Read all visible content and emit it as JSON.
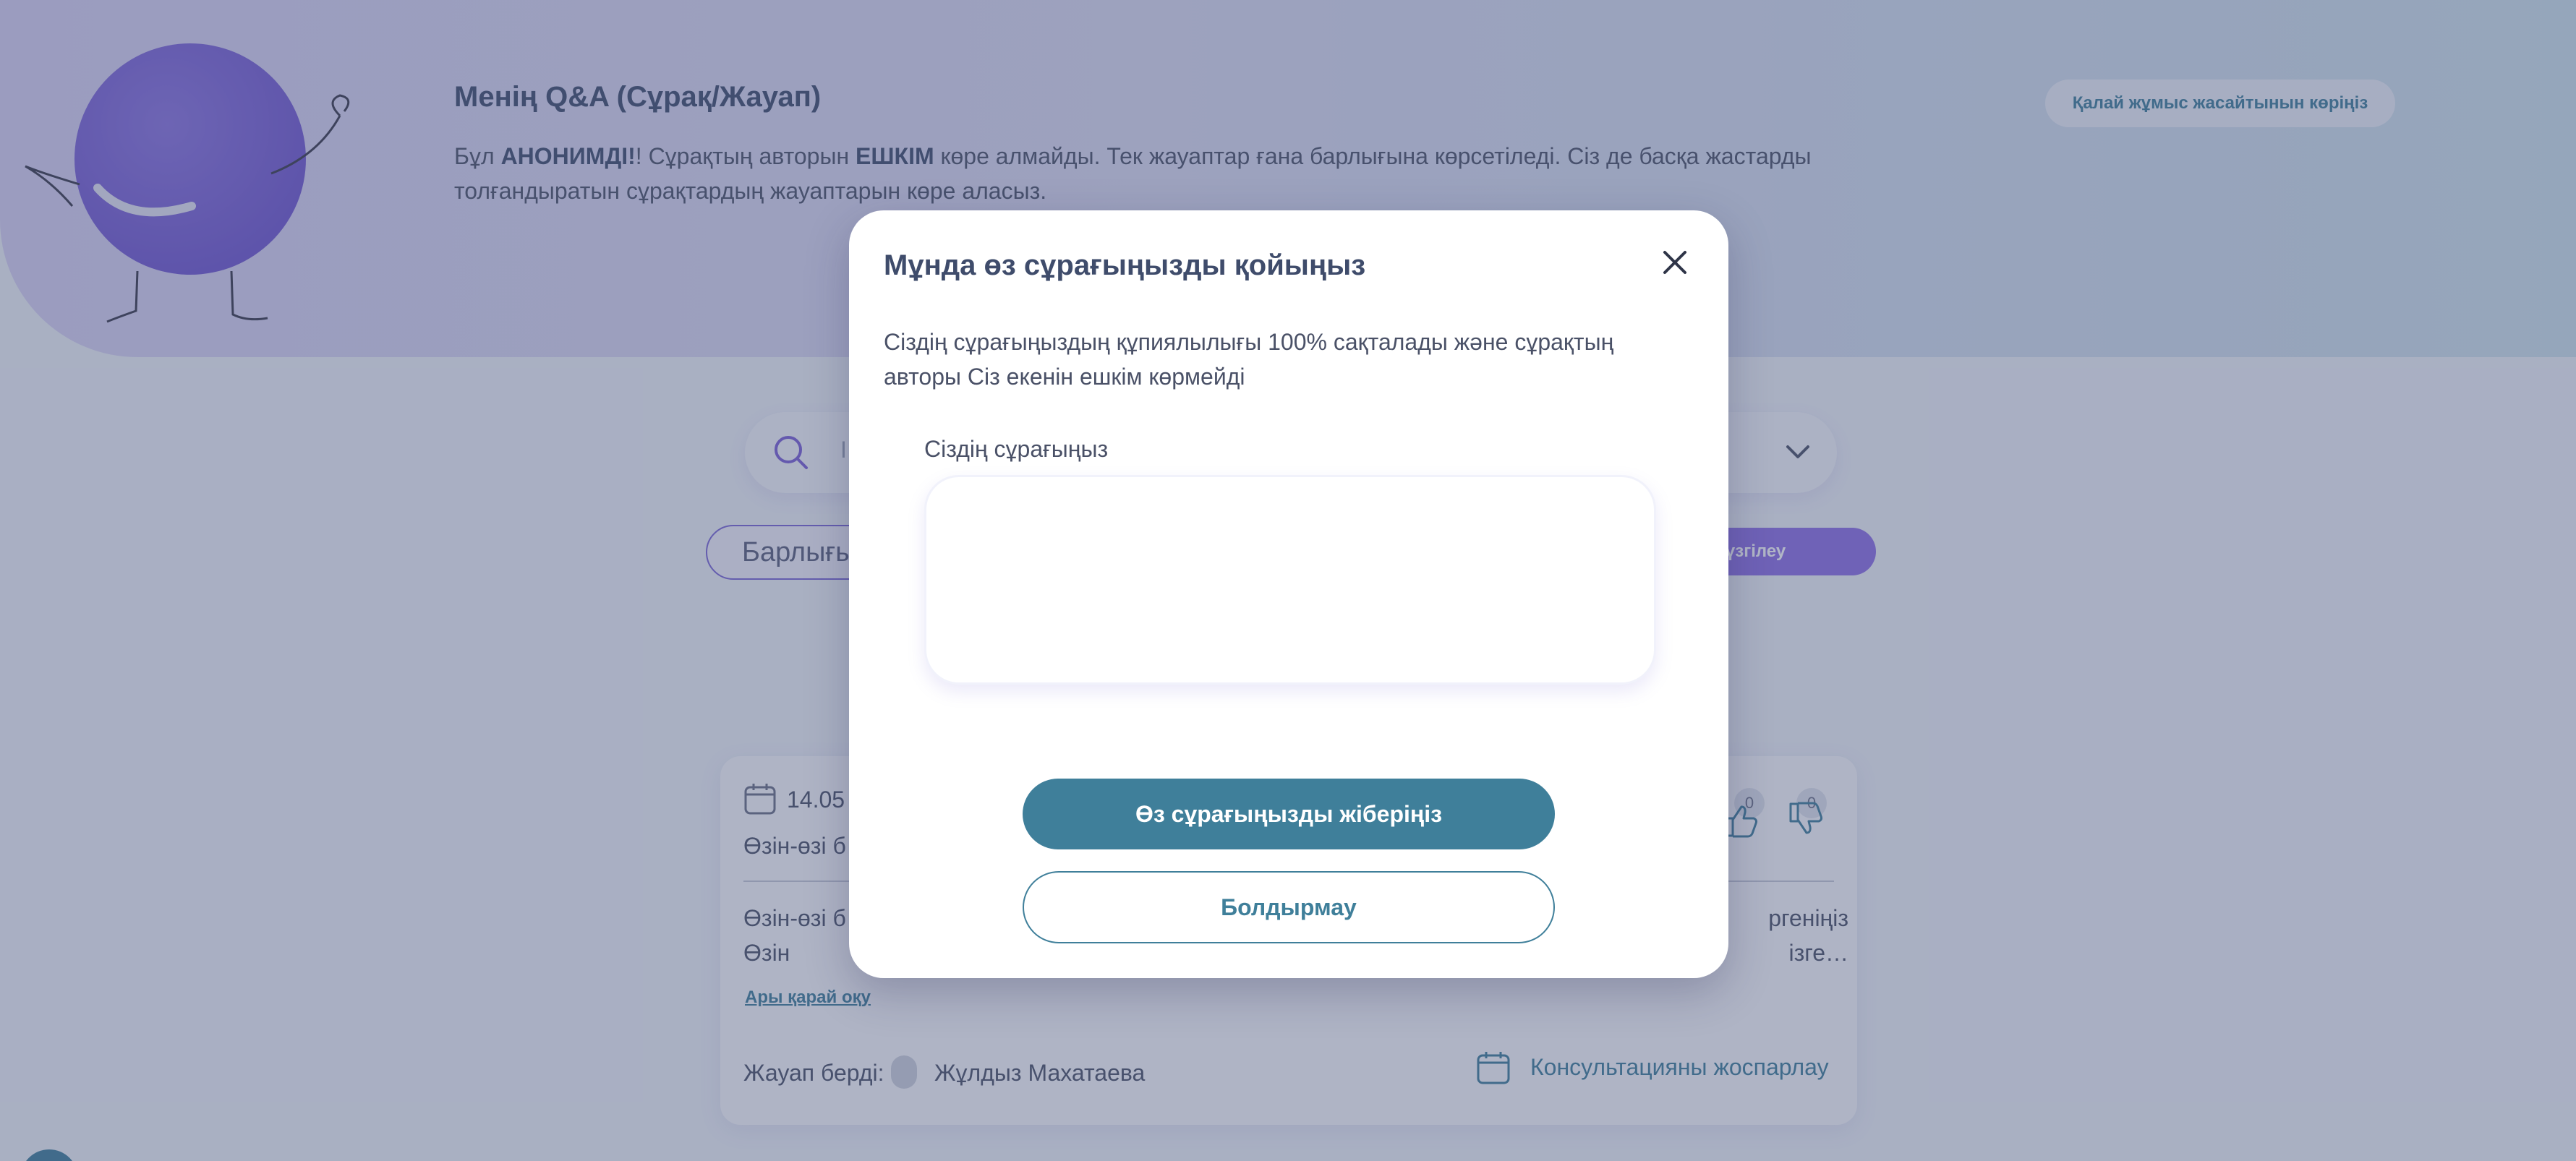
{
  "hero": {
    "title": "Менің Q&A (Сұрақ/Жауап)",
    "desc_prefix": "Бұл ",
    "desc_anon": "АНОНИМДІ!",
    "desc_mid": "! Сұрақтың авторын ",
    "desc_nobody": "ЕШКІМ",
    "desc_rest": " көре алмайды. Тек жауаптар ғана барлығына көрсетіледі. Сіз де басқа жастарды толғандыратын сұрақтардың жауаптарын көре аласыз.",
    "how_button": "Қалай жұмыс жасайтынын көріңіз"
  },
  "search": {
    "placeholder": "І"
  },
  "filters": {
    "all_label": "Барлығы",
    "apply_label": "...терді сүзгілеу"
  },
  "card": {
    "date": "14.05",
    "question": "Өзін-өзі б",
    "answer_left": "Өзін-өзі б жөн. Өзін",
    "answer_right": "ргеніңіз ізге…",
    "read_more": "Ары қарай оқу",
    "answered_label": "Жауап берді:",
    "answered_name": "Жұлдыз Махатаева",
    "consult_link": "Консультацияны жоспарлау",
    "likes": "0",
    "dislikes": "0"
  },
  "modal": {
    "title": "Мұнда өз сұрағыңызды қойыңыз",
    "description": "Сіздің сұрағыңыздың құпиялылығы 100% сақталады және сұрақтың авторы Сіз екенін ешкім көрмейді",
    "field_label": "Сіздің сұрағыңыз",
    "field_value": "",
    "submit_label": "Өз сұрағыңызды жіберіңіз",
    "cancel_label": "Болдырмау"
  },
  "colors": {
    "accent": "#3f7f9a",
    "brand_purple": "#7b5fd6",
    "title": "#3f4c6b"
  }
}
